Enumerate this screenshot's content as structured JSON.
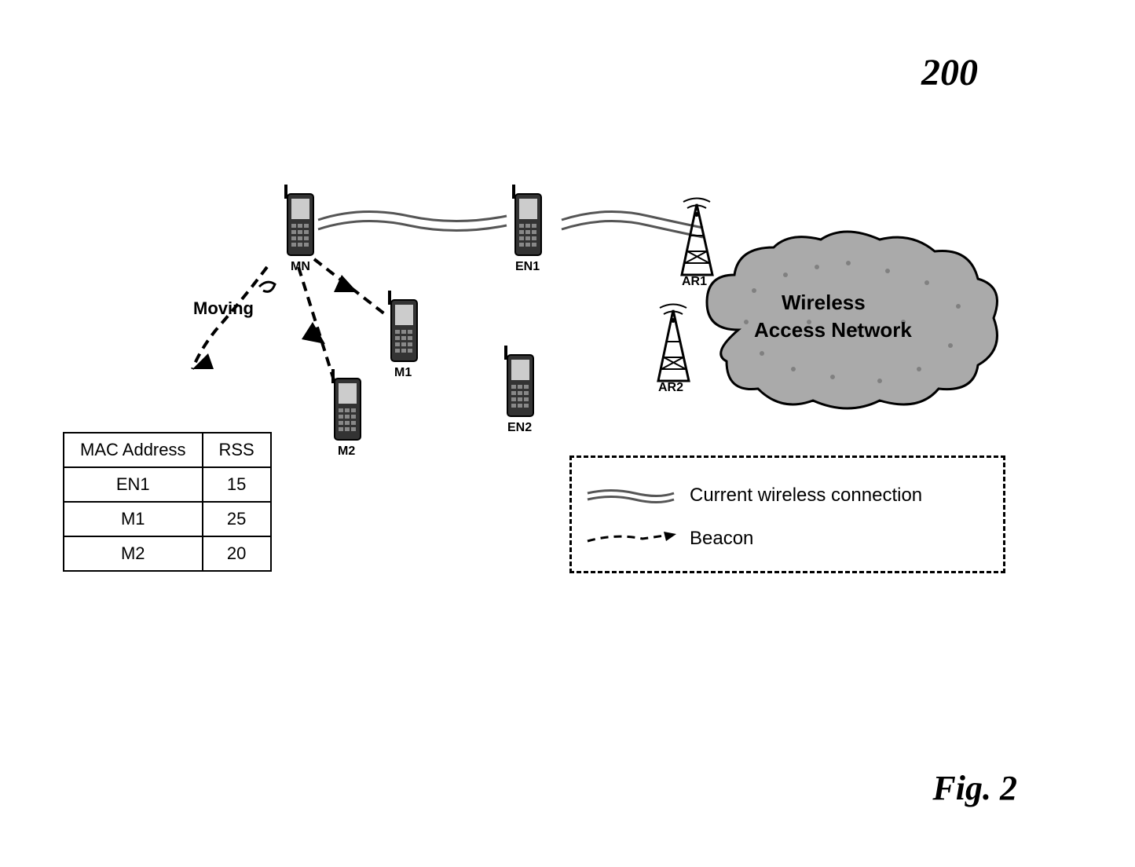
{
  "figure_number": "200",
  "figure_caption": "Fig. 2",
  "nodes": {
    "mn": {
      "label": "MN"
    },
    "en1": {
      "label": "EN1"
    },
    "en2": {
      "label": "EN2"
    },
    "m1": {
      "label": "M1"
    },
    "m2": {
      "label": "M2"
    },
    "ar1": {
      "label": "AR1"
    },
    "ar2": {
      "label": "AR2"
    }
  },
  "cloud": {
    "line1": "Wireless",
    "line2": "Access Network"
  },
  "moving_label": "Moving",
  "table": {
    "headers": [
      "MAC Address",
      "RSS"
    ],
    "rows": [
      {
        "mac": "EN1",
        "rss": "15"
      },
      {
        "mac": "M1",
        "rss": "25"
      },
      {
        "mac": "M2",
        "rss": "20"
      }
    ]
  },
  "legend": {
    "current": "Current wireless connection",
    "beacon": "Beacon"
  }
}
